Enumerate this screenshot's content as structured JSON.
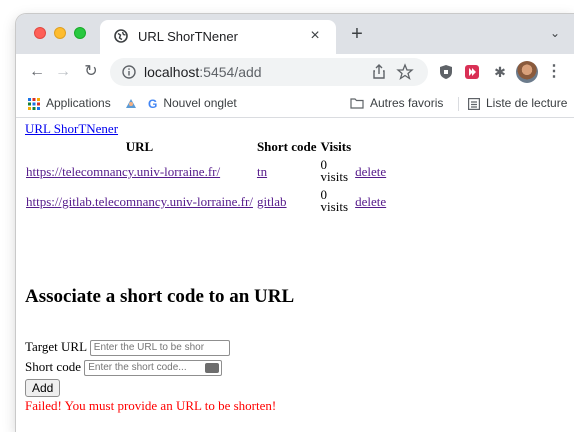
{
  "browser": {
    "tab_title": "URL ShorTNener",
    "tab_close": "×",
    "new_tab": "+",
    "tab_menu": "⌄",
    "url_host": "localhost",
    "url_path": ":5454/add",
    "bookmarks": [
      {
        "label": "Applications"
      },
      {
        "label": "Nouvel onglet"
      },
      {
        "label": "Autres favoris"
      },
      {
        "label": "Liste de lecture"
      }
    ],
    "colors": {
      "tab_strip": "#dee1e6",
      "omnibox": "#f1f3f4"
    }
  },
  "page": {
    "home_link": "URL ShorTNener",
    "table": {
      "headers": [
        "URL",
        "Short code",
        "Visits"
      ],
      "rows": [
        {
          "url": "https://telecomnancy.univ-lorraine.fr/",
          "code": "tn",
          "visits_count": "0",
          "visits_label": "visits",
          "action": "delete"
        },
        {
          "url": "https://gitlab.telecomnancy.univ-lorraine.fr/",
          "code": "gitlab",
          "visits_count": "0",
          "visits_label": "visits",
          "action": "delete"
        }
      ]
    },
    "form": {
      "heading": "Associate a short code to an URL",
      "target_label": "Target URL",
      "target_placeholder": "Enter the URL to be shor",
      "short_label": "Short code",
      "short_placeholder": "Enter the short code...",
      "submit_label": "Add"
    },
    "error": "Failed! You must provide an URL to be shorten!",
    "colors": {
      "error": "#ff0000",
      "link": "#551a8b"
    }
  }
}
